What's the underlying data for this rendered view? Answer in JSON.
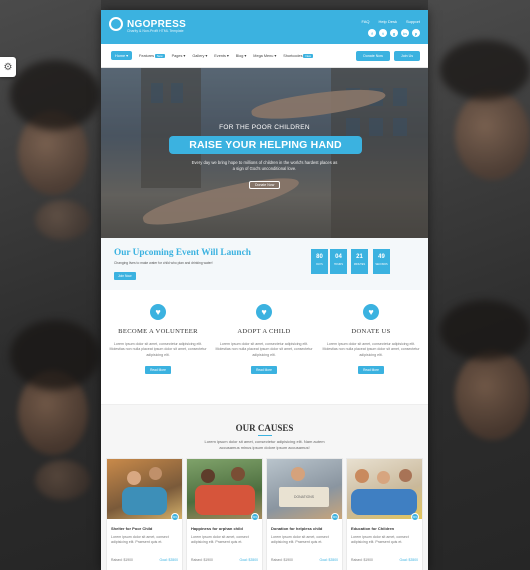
{
  "colors": {
    "accent": "#3bb2e0",
    "text": "#333333",
    "muted": "#777777"
  },
  "settings": {
    "icon": "gear-icon"
  },
  "header": {
    "brand": "NGOPRESS",
    "tagline": "Charity & Non-Profit HTML Template",
    "links": [
      "FAQ",
      "Help Desk",
      "Support"
    ],
    "socials": [
      "f",
      "t",
      "g",
      "in",
      "p"
    ]
  },
  "nav": {
    "items": [
      {
        "label": "Home",
        "badge": ""
      },
      {
        "label": "Features",
        "badge": "New"
      },
      {
        "label": "Pages",
        "badge": ""
      },
      {
        "label": "Gallery",
        "badge": ""
      },
      {
        "label": "Events",
        "badge": ""
      },
      {
        "label": "Blog",
        "badge": ""
      },
      {
        "label": "Mega Menu",
        "badge": ""
      },
      {
        "label": "Shortcodes",
        "badge": "New"
      }
    ],
    "donate": "Donate Now",
    "join": "Join Us"
  },
  "hero": {
    "kicker": "FOR THE POOR CHILDREN",
    "title": "RAISE YOUR HELPING HAND",
    "desc": "Every day we bring hope to millions of children in the world's hardest places as a sign of God's unconditional love.",
    "cta": "Donate Now"
  },
  "event": {
    "title": "Our Upcoming Event Will Launch",
    "subtitle": "Changing lives to make water for child who plan and drinking water!",
    "join": "Join Now",
    "countdown": [
      {
        "value": "80",
        "label": "DAYS"
      },
      {
        "value": "04",
        "label": "HOURS"
      },
      {
        "value": "21",
        "label": "MINUTES"
      },
      {
        "value": "49",
        "label": "SECONDS"
      }
    ]
  },
  "features": [
    {
      "icon": "globe-heart-icon",
      "title": "BECOME A VOLUNTEER",
      "text": "Lorem ipsum dolor sit amet, consectetur adipisicing elit. Molestias non nulla placeat ipsum dolor sit amet, consectetur adipisicing elit.",
      "button": "Read More"
    },
    {
      "icon": "hands-heart-icon",
      "title": "ADOPT A CHILD",
      "text": "Lorem ipsum dolor sit amet, consectetur adipisicing elit. Molestias non nulla placeat ipsum dolor sit amet, consectetur adipisicing elit.",
      "button": "Read More"
    },
    {
      "icon": "donate-heart-icon",
      "title": "DONATE US",
      "text": "Lorem ipsum dolor sit amet, consectetur adipisicing elit. Molestias non nulla placeat ipsum dolor sit amet, consectetur adipisicing elit.",
      "button": "Read More"
    }
  ],
  "causes": {
    "title": "OUR CAUSES",
    "desc": "Lorem ipsum dolor sit amet, consectetur adipisicing elit. Nam autem accusamus minus ipsum dolore ipsum accusamus!",
    "cards": [
      {
        "title": "Shelter for Poor Child",
        "text": "Lorem ipsum dolor sit amet, consect adipisicing elit. Praesent quis et.",
        "raised": "Raised: $1900",
        "goal": "Goal: $3500",
        "pct": "54%"
      },
      {
        "title": "Happiness for orphan child",
        "text": "Lorem ipsum dolor sit amet, consect adipisicing elit. Praesent quis et.",
        "raised": "Raised: $1900",
        "goal": "Goal: $3500",
        "pct": "54%"
      },
      {
        "title": "Donation for helpless child",
        "text": "Lorem ipsum dolor sit amet, consect adipisicing elit. Praesent quis et.",
        "raised": "Raised: $1900",
        "goal": "Goal: $3500",
        "pct": "54%"
      },
      {
        "title": "Education for Children",
        "text": "Lorem ipsum dolor sit amet, consect adipisicing elit. Praesent quis et.",
        "raised": "Raised: $1900",
        "goal": "Goal: $3500",
        "pct": "54%"
      }
    ],
    "donations_sign": "DONATIONS"
  }
}
